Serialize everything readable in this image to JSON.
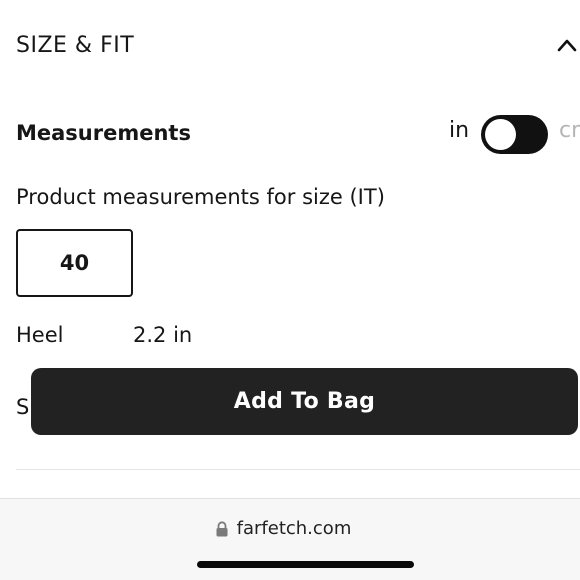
{
  "section": {
    "title": "SIZE & FIT",
    "collapse_icon": "chevron-up-icon"
  },
  "measurements": {
    "title": "Measurements",
    "unit_in_label": "in",
    "unit_cm_label": "cm",
    "toggle_state": "in"
  },
  "product": {
    "subtitle": "Product measurements for size (IT)",
    "selected_size": "40",
    "rows": [
      {
        "label": "Heel",
        "value": "2.2 in"
      },
      {
        "label": "S",
        "value": ""
      }
    ]
  },
  "cta": {
    "add_to_bag_label": "Add To Bag"
  },
  "browser": {
    "url": "farfetch.com",
    "lock_icon": "lock-icon"
  },
  "colors": {
    "button_bg": "#222222",
    "text": "#161616",
    "muted": "#b5b5b5"
  }
}
